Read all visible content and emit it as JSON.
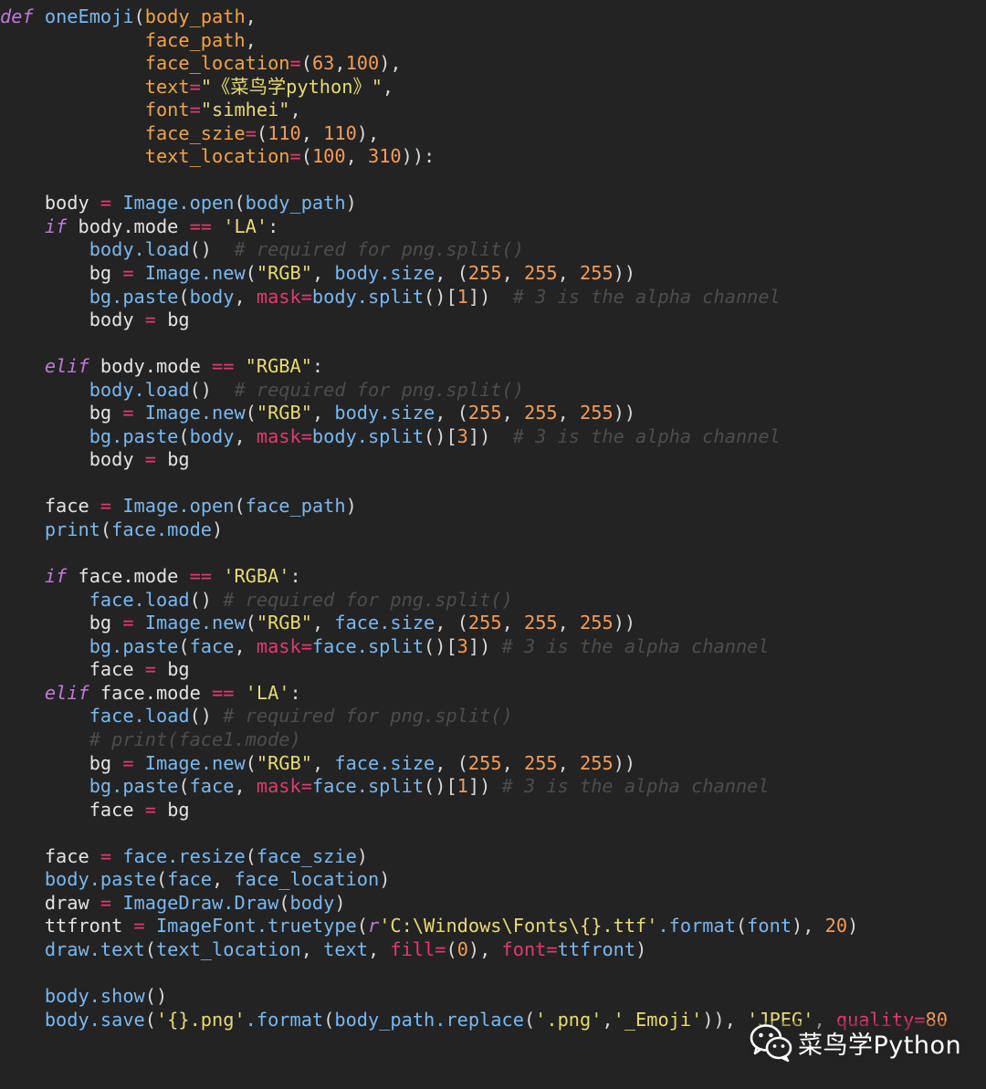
{
  "watermark": {
    "text": "菜鸟学Python",
    "icon": "wechat-icon"
  },
  "colors": {
    "background": "#232323",
    "keyword": "#c17ad9",
    "function": "#79b8f0",
    "parameter": "#f0a34a",
    "operator": "#e5396f",
    "string": "#e6db74",
    "number": "#f39c57",
    "comment": "#4d4d4d",
    "text": "#e3e3e3"
  },
  "code": {
    "lines": [
      [
        [
          "kw",
          "def"
        ],
        [
          "pn",
          " "
        ],
        [
          "fn",
          "oneEmoji"
        ],
        [
          "pn",
          "("
        ],
        [
          "pr",
          "body_path"
        ],
        [
          "pn",
          ","
        ]
      ],
      [
        [
          "pn",
          "             "
        ],
        [
          "pr",
          "face_path"
        ],
        [
          "pn",
          ","
        ]
      ],
      [
        [
          "pn",
          "             "
        ],
        [
          "pr",
          "face_location"
        ],
        [
          "op",
          "="
        ],
        [
          "pn",
          "("
        ],
        [
          "nm",
          "63"
        ],
        [
          "pn",
          ","
        ],
        [
          "nm",
          "100"
        ],
        [
          "pn",
          "),"
        ]
      ],
      [
        [
          "pn",
          "             "
        ],
        [
          "pr",
          "text"
        ],
        [
          "op",
          "="
        ],
        [
          "st",
          "\"《菜鸟学python》\""
        ],
        [
          "pn",
          ","
        ]
      ],
      [
        [
          "pn",
          "             "
        ],
        [
          "pr",
          "font"
        ],
        [
          "op",
          "="
        ],
        [
          "st",
          "\"simhei\""
        ],
        [
          "pn",
          ","
        ]
      ],
      [
        [
          "pn",
          "             "
        ],
        [
          "pr",
          "face_szie"
        ],
        [
          "op",
          "="
        ],
        [
          "pn",
          "("
        ],
        [
          "nm",
          "110"
        ],
        [
          "pn",
          ", "
        ],
        [
          "nm",
          "110"
        ],
        [
          "pn",
          "),"
        ]
      ],
      [
        [
          "pn",
          "             "
        ],
        [
          "pr",
          "text_location"
        ],
        [
          "op",
          "="
        ],
        [
          "pn",
          "("
        ],
        [
          "nm",
          "100"
        ],
        [
          "pn",
          ", "
        ],
        [
          "nm",
          "310"
        ],
        [
          "pn",
          ")):"
        ]
      ],
      [],
      [
        [
          "pn",
          "    "
        ],
        [
          "id",
          "body "
        ],
        [
          "op",
          "="
        ],
        [
          "pn",
          " "
        ],
        [
          "fn",
          "Image.open"
        ],
        [
          "pn",
          "("
        ],
        [
          "fn",
          "body_path"
        ],
        [
          "pn",
          ")"
        ]
      ],
      [
        [
          "pn",
          "    "
        ],
        [
          "kw",
          "if"
        ],
        [
          "pn",
          " "
        ],
        [
          "id",
          "body.mode "
        ],
        [
          "op",
          "=="
        ],
        [
          "pn",
          " "
        ],
        [
          "st",
          "'LA'"
        ],
        [
          "pn",
          ":"
        ]
      ],
      [
        [
          "pn",
          "        "
        ],
        [
          "fn",
          "body.load"
        ],
        [
          "pn",
          "()"
        ],
        [
          "pn",
          "  "
        ],
        [
          "cm",
          "# required for png.split()"
        ]
      ],
      [
        [
          "pn",
          "        "
        ],
        [
          "id",
          "bg "
        ],
        [
          "op",
          "="
        ],
        [
          "pn",
          " "
        ],
        [
          "fn",
          "Image.new"
        ],
        [
          "pn",
          "("
        ],
        [
          "st",
          "\"RGB\""
        ],
        [
          "pn",
          ", "
        ],
        [
          "fn",
          "body.size"
        ],
        [
          "pn",
          ", ("
        ],
        [
          "nm",
          "255"
        ],
        [
          "pn",
          ", "
        ],
        [
          "nm",
          "255"
        ],
        [
          "pn",
          ", "
        ],
        [
          "nm",
          "255"
        ],
        [
          "pn",
          "))"
        ]
      ],
      [
        [
          "pn",
          "        "
        ],
        [
          "fn",
          "bg.paste"
        ],
        [
          "pn",
          "("
        ],
        [
          "fn",
          "body"
        ],
        [
          "pn",
          ", "
        ],
        [
          "op",
          "mask"
        ],
        [
          "op",
          "="
        ],
        [
          "fn",
          "body.split"
        ],
        [
          "pn",
          "()["
        ],
        [
          "nm",
          "1"
        ],
        [
          "pn",
          "])"
        ],
        [
          "pn",
          "  "
        ],
        [
          "cm",
          "# 3 is the alpha channel"
        ]
      ],
      [
        [
          "pn",
          "        "
        ],
        [
          "id",
          "body "
        ],
        [
          "op",
          "="
        ],
        [
          "pn",
          " "
        ],
        [
          "id",
          "bg"
        ]
      ],
      [],
      [
        [
          "pn",
          "    "
        ],
        [
          "kw",
          "elif"
        ],
        [
          "pn",
          " "
        ],
        [
          "id",
          "body.mode "
        ],
        [
          "op",
          "=="
        ],
        [
          "pn",
          " "
        ],
        [
          "st",
          "\"RGBA\""
        ],
        [
          "pn",
          ":"
        ]
      ],
      [
        [
          "pn",
          "        "
        ],
        [
          "fn",
          "body.load"
        ],
        [
          "pn",
          "()"
        ],
        [
          "pn",
          "  "
        ],
        [
          "cm",
          "# required for png.split()"
        ]
      ],
      [
        [
          "pn",
          "        "
        ],
        [
          "id",
          "bg "
        ],
        [
          "op",
          "="
        ],
        [
          "pn",
          " "
        ],
        [
          "fn",
          "Image.new"
        ],
        [
          "pn",
          "("
        ],
        [
          "st",
          "\"RGB\""
        ],
        [
          "pn",
          ", "
        ],
        [
          "fn",
          "body.size"
        ],
        [
          "pn",
          ", ("
        ],
        [
          "nm",
          "255"
        ],
        [
          "pn",
          ", "
        ],
        [
          "nm",
          "255"
        ],
        [
          "pn",
          ", "
        ],
        [
          "nm",
          "255"
        ],
        [
          "pn",
          "))"
        ]
      ],
      [
        [
          "pn",
          "        "
        ],
        [
          "fn",
          "bg.paste"
        ],
        [
          "pn",
          "("
        ],
        [
          "fn",
          "body"
        ],
        [
          "pn",
          ", "
        ],
        [
          "op",
          "mask"
        ],
        [
          "op",
          "="
        ],
        [
          "fn",
          "body.split"
        ],
        [
          "pn",
          "()["
        ],
        [
          "nm",
          "3"
        ],
        [
          "pn",
          "])"
        ],
        [
          "pn",
          "  "
        ],
        [
          "cm",
          "# 3 is the alpha channel"
        ]
      ],
      [
        [
          "pn",
          "        "
        ],
        [
          "id",
          "body "
        ],
        [
          "op",
          "="
        ],
        [
          "pn",
          " "
        ],
        [
          "id",
          "bg"
        ]
      ],
      [],
      [
        [
          "pn",
          "    "
        ],
        [
          "id",
          "face "
        ],
        [
          "op",
          "="
        ],
        [
          "pn",
          " "
        ],
        [
          "fn",
          "Image.open"
        ],
        [
          "pn",
          "("
        ],
        [
          "fn",
          "face_path"
        ],
        [
          "pn",
          ")"
        ]
      ],
      [
        [
          "pn",
          "    "
        ],
        [
          "fn",
          "print"
        ],
        [
          "pn",
          "("
        ],
        [
          "fn",
          "face.mode"
        ],
        [
          "pn",
          ")"
        ]
      ],
      [],
      [
        [
          "pn",
          "    "
        ],
        [
          "kw",
          "if"
        ],
        [
          "pn",
          " "
        ],
        [
          "id",
          "face.mode "
        ],
        [
          "op",
          "=="
        ],
        [
          "pn",
          " "
        ],
        [
          "st",
          "'RGBA'"
        ],
        [
          "pn",
          ":"
        ]
      ],
      [
        [
          "pn",
          "        "
        ],
        [
          "fn",
          "face.load"
        ],
        [
          "pn",
          "()"
        ],
        [
          "pn",
          " "
        ],
        [
          "cm",
          "# required for png.split()"
        ]
      ],
      [
        [
          "pn",
          "        "
        ],
        [
          "id",
          "bg "
        ],
        [
          "op",
          "="
        ],
        [
          "pn",
          " "
        ],
        [
          "fn",
          "Image.new"
        ],
        [
          "pn",
          "("
        ],
        [
          "st",
          "\"RGB\""
        ],
        [
          "pn",
          ", "
        ],
        [
          "fn",
          "face.size"
        ],
        [
          "pn",
          ", ("
        ],
        [
          "nm",
          "255"
        ],
        [
          "pn",
          ", "
        ],
        [
          "nm",
          "255"
        ],
        [
          "pn",
          ", "
        ],
        [
          "nm",
          "255"
        ],
        [
          "pn",
          "))"
        ]
      ],
      [
        [
          "pn",
          "        "
        ],
        [
          "fn",
          "bg.paste"
        ],
        [
          "pn",
          "("
        ],
        [
          "fn",
          "face"
        ],
        [
          "pn",
          ", "
        ],
        [
          "op",
          "mask"
        ],
        [
          "op",
          "="
        ],
        [
          "fn",
          "face.split"
        ],
        [
          "pn",
          "()["
        ],
        [
          "nm",
          "3"
        ],
        [
          "pn",
          "])"
        ],
        [
          "pn",
          " "
        ],
        [
          "cm",
          "# 3 is the alpha channel"
        ]
      ],
      [
        [
          "pn",
          "        "
        ],
        [
          "id",
          "face "
        ],
        [
          "op",
          "="
        ],
        [
          "pn",
          " "
        ],
        [
          "id",
          "bg"
        ]
      ],
      [
        [
          "pn",
          "    "
        ],
        [
          "kw",
          "elif"
        ],
        [
          "pn",
          " "
        ],
        [
          "id",
          "face.mode "
        ],
        [
          "op",
          "=="
        ],
        [
          "pn",
          " "
        ],
        [
          "st",
          "'LA'"
        ],
        [
          "pn",
          ":"
        ]
      ],
      [
        [
          "pn",
          "        "
        ],
        [
          "fn",
          "face.load"
        ],
        [
          "pn",
          "()"
        ],
        [
          "pn",
          " "
        ],
        [
          "cm",
          "# required for png.split()"
        ]
      ],
      [
        [
          "pn",
          "        "
        ],
        [
          "cm",
          "# print(face1.mode)"
        ]
      ],
      [
        [
          "pn",
          "        "
        ],
        [
          "id",
          "bg "
        ],
        [
          "op",
          "="
        ],
        [
          "pn",
          " "
        ],
        [
          "fn",
          "Image.new"
        ],
        [
          "pn",
          "("
        ],
        [
          "st",
          "\"RGB\""
        ],
        [
          "pn",
          ", "
        ],
        [
          "fn",
          "face.size"
        ],
        [
          "pn",
          ", ("
        ],
        [
          "nm",
          "255"
        ],
        [
          "pn",
          ", "
        ],
        [
          "nm",
          "255"
        ],
        [
          "pn",
          ", "
        ],
        [
          "nm",
          "255"
        ],
        [
          "pn",
          "))"
        ]
      ],
      [
        [
          "pn",
          "        "
        ],
        [
          "fn",
          "bg.paste"
        ],
        [
          "pn",
          "("
        ],
        [
          "fn",
          "face"
        ],
        [
          "pn",
          ", "
        ],
        [
          "op",
          "mask"
        ],
        [
          "op",
          "="
        ],
        [
          "fn",
          "face.split"
        ],
        [
          "pn",
          "()["
        ],
        [
          "nm",
          "1"
        ],
        [
          "pn",
          "])"
        ],
        [
          "pn",
          " "
        ],
        [
          "cm",
          "# 3 is the alpha channel"
        ]
      ],
      [
        [
          "pn",
          "        "
        ],
        [
          "id",
          "face "
        ],
        [
          "op",
          "="
        ],
        [
          "pn",
          " "
        ],
        [
          "id",
          "bg"
        ]
      ],
      [],
      [
        [
          "pn",
          "    "
        ],
        [
          "id",
          "face "
        ],
        [
          "op",
          "="
        ],
        [
          "pn",
          " "
        ],
        [
          "fn",
          "face.resize"
        ],
        [
          "pn",
          "("
        ],
        [
          "fn",
          "face_szie"
        ],
        [
          "pn",
          ")"
        ]
      ],
      [
        [
          "pn",
          "    "
        ],
        [
          "fn",
          "body.paste"
        ],
        [
          "pn",
          "("
        ],
        [
          "fn",
          "face"
        ],
        [
          "pn",
          ", "
        ],
        [
          "fn",
          "face_location"
        ],
        [
          "pn",
          ")"
        ]
      ],
      [
        [
          "pn",
          "    "
        ],
        [
          "id",
          "draw "
        ],
        [
          "op",
          "="
        ],
        [
          "pn",
          " "
        ],
        [
          "fn",
          "ImageDraw.Draw"
        ],
        [
          "pn",
          "("
        ],
        [
          "fn",
          "body"
        ],
        [
          "pn",
          ")"
        ]
      ],
      [
        [
          "pn",
          "    "
        ],
        [
          "id",
          "ttfront "
        ],
        [
          "op",
          "="
        ],
        [
          "pn",
          " "
        ],
        [
          "fn",
          "ImageFont.truetype"
        ],
        [
          "pn",
          "("
        ],
        [
          "kw",
          "r"
        ],
        [
          "st",
          "'C:\\Windows\\Fonts\\{}.ttf'"
        ],
        [
          "fn",
          ".format"
        ],
        [
          "pn",
          "("
        ],
        [
          "fn",
          "font"
        ],
        [
          "pn",
          "), "
        ],
        [
          "nm",
          "20"
        ],
        [
          "pn",
          ")"
        ]
      ],
      [
        [
          "pn",
          "    "
        ],
        [
          "fn",
          "draw.text"
        ],
        [
          "pn",
          "("
        ],
        [
          "fn",
          "text_location"
        ],
        [
          "pn",
          ", "
        ],
        [
          "fn",
          "text"
        ],
        [
          "pn",
          ", "
        ],
        [
          "op",
          "fill"
        ],
        [
          "op",
          "="
        ],
        [
          "pn",
          "("
        ],
        [
          "nm",
          "0"
        ],
        [
          "pn",
          "), "
        ],
        [
          "op",
          "font"
        ],
        [
          "op",
          "="
        ],
        [
          "fn",
          "ttfront"
        ],
        [
          "pn",
          ")"
        ]
      ],
      [],
      [
        [
          "pn",
          "    "
        ],
        [
          "fn",
          "body.show"
        ],
        [
          "pn",
          "()"
        ]
      ],
      [
        [
          "pn",
          "    "
        ],
        [
          "fn",
          "body.save"
        ],
        [
          "pn",
          "("
        ],
        [
          "st",
          "'{}.png'"
        ],
        [
          "fn",
          ".format"
        ],
        [
          "pn",
          "("
        ],
        [
          "fn",
          "body_path.replace"
        ],
        [
          "pn",
          "("
        ],
        [
          "st",
          "'.png'"
        ],
        [
          "pn",
          ","
        ],
        [
          "st",
          "'_Emoji'"
        ],
        [
          "pn",
          "))"
        ],
        [
          "pn",
          ", "
        ],
        [
          "st",
          "'JPEG'"
        ],
        [
          "pn",
          ", "
        ],
        [
          "op",
          "quality"
        ],
        [
          "op",
          "="
        ],
        [
          "nm",
          "80"
        ]
      ]
    ]
  }
}
